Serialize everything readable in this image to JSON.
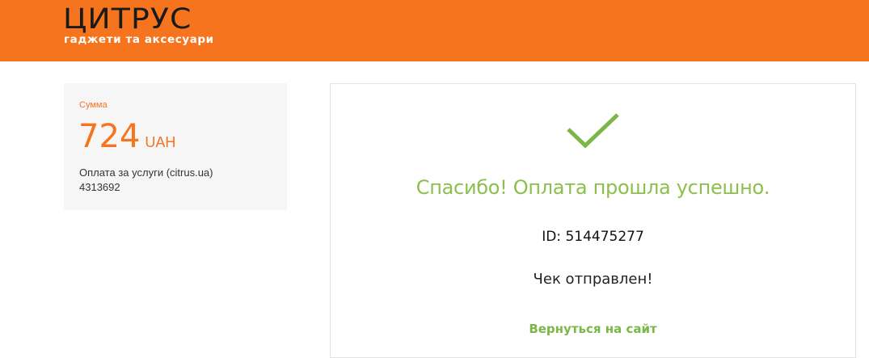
{
  "header": {
    "logo_text": "ЦИТРУС",
    "tagline": "гаджети та аксесуари",
    "brand_color": "#f7741e"
  },
  "summary": {
    "label": "Сумма",
    "amount": "724",
    "currency": "UAH",
    "description": "Оплата за услуги (citrus.ua)",
    "order_number": "4313692"
  },
  "result": {
    "icon": "checkmark-icon",
    "title": "Спасибо! Оплата прошла успешно.",
    "id_label": "ID:",
    "id_value": "514475277",
    "receipt_status": "Чек отправлен!",
    "return_link": "Вернуться на сайт",
    "success_color": "#8cbf4d"
  }
}
